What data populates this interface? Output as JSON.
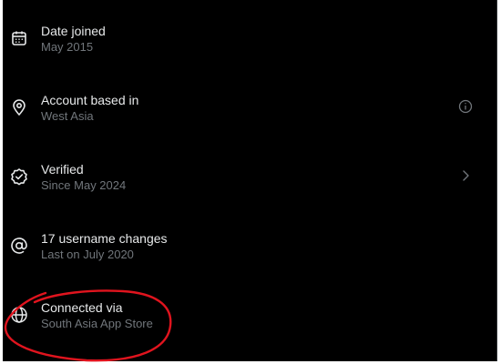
{
  "account_info": {
    "items": [
      {
        "icon": "calendar-icon",
        "title": "Date joined",
        "subtitle": "May 2015",
        "trailing": null
      },
      {
        "icon": "location-pin-icon",
        "title": "Account based in",
        "subtitle": "West Asia",
        "trailing": "info-icon"
      },
      {
        "icon": "verified-badge-icon",
        "title": "Verified",
        "subtitle": "Since May 2024",
        "trailing": "chevron-right-icon"
      },
      {
        "icon": "at-sign-icon",
        "title": "17 username changes",
        "subtitle": "Last on July 2020",
        "trailing": null
      },
      {
        "icon": "globe-icon",
        "title": "Connected via",
        "subtitle": "South Asia App Store",
        "trailing": null
      }
    ]
  },
  "colors": {
    "background": "#000000",
    "primary_text": "#e7e9ea",
    "secondary_text": "#71767b",
    "annotation": "#e0141e"
  }
}
